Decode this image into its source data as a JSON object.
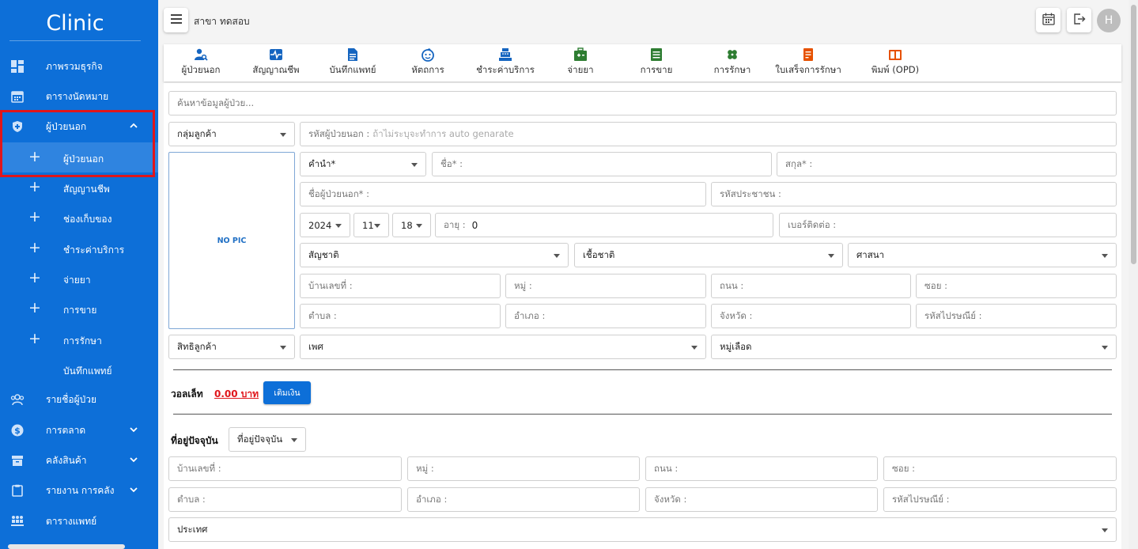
{
  "sidebar": {
    "brand": "Clinic",
    "items": [
      {
        "label": "ภาพรวมธุรกิจ",
        "icon": "dashboard-icon"
      },
      {
        "label": "ตารางนัดหมาย",
        "icon": "calendar-icon"
      },
      {
        "label": "ผู้ป่วยนอก",
        "icon": "shield-icon",
        "expanded": true
      },
      {
        "label": "รายชื่อผู้ป่วย",
        "icon": "users-icon"
      },
      {
        "label": "การตลาด",
        "icon": "dollar-icon"
      },
      {
        "label": "คลังสินค้า",
        "icon": "archive-icon"
      },
      {
        "label": "รายงาน การคลัง",
        "icon": "clipboard-icon"
      },
      {
        "label": "ตารางแพทย์",
        "icon": "doctors-icon"
      }
    ],
    "subitems": [
      {
        "label": "ผู้ป่วยนอก",
        "plus": true,
        "active": true
      },
      {
        "label": "สัญญานชีพ",
        "plus": true
      },
      {
        "label": "ช่องเก็บของ",
        "plus": true
      },
      {
        "label": "ชำระค่าบริการ",
        "plus": true
      },
      {
        "label": "จ่ายยา",
        "plus": true
      },
      {
        "label": "การขาย",
        "plus": true
      },
      {
        "label": "การรักษา",
        "plus": true
      },
      {
        "label": "บันทึกแพทย์",
        "plus": false
      }
    ]
  },
  "topbar": {
    "branch": "สาขา ทดสอบ",
    "avatar_letter": "H"
  },
  "tabs": [
    {
      "label": "ผู้ป่วยนอก",
      "icon": "patient-search-icon",
      "color": "#1565c0"
    },
    {
      "label": "สัญญาณชีพ",
      "icon": "vital-signs-icon",
      "color": "#1565c0"
    },
    {
      "label": "บันทึกแพทย์",
      "icon": "document-icon",
      "color": "#1565c0"
    },
    {
      "label": "หัตถการ",
      "icon": "baby-face-icon",
      "color": "#1565c0"
    },
    {
      "label": "ชำระค่าบริการ",
      "icon": "cash-register-icon",
      "color": "#1565c0"
    },
    {
      "label": "จ่ายยา",
      "icon": "medicine-kit-icon",
      "color": "#2e7d32"
    },
    {
      "label": "การขาย",
      "icon": "receipt-list-icon",
      "color": "#2e7d32"
    },
    {
      "label": "การรักษา",
      "icon": "bandage-icon",
      "color": "#2e7d32"
    },
    {
      "label": "ใบเสร็จการรักษา",
      "icon": "receipt-icon",
      "color": "#e65100"
    },
    {
      "label": "พิมพ์ (OPD)",
      "icon": "book-icon",
      "color": "#e65100"
    }
  ],
  "form": {
    "search_placeholder": "ค้นหาข้อมูลผู้ป่วย...",
    "customer_group": "กลุ่มลูกค้า",
    "patient_code_label": "รหัสผู้ป่วยนอก :",
    "patient_code_placeholder": "ถ้าไม่ระบุจะทำการ auto genarate",
    "no_pic": "NO PIC",
    "prefix": "คำนำ*",
    "first_name": "ชื่อ* :",
    "last_name": "สกุล* :",
    "outpatient_name": "ชื่อผู้ป่วยนอก* :",
    "citizen_id": "รหัสประชาชน :",
    "year": "2024",
    "month": "11",
    "day": "18",
    "age_label": "อายุ :",
    "age_value": "0",
    "phone": "เบอร์ติดต่อ :",
    "nationality": "สัญชาติ",
    "race": "เชื้อชาติ",
    "religion": "ศาสนา",
    "house_no": "บ้านเลขที่ :",
    "moo": "หมู่ :",
    "road": "ถนน :",
    "soi": "ซอย :",
    "subdistrict": "ตำบล :",
    "district": "อำเภอ :",
    "province": "จังหวัด :",
    "postcode": "รหัสไปรษณีย์ :",
    "customer_right": "สิทธิลูกค้า",
    "gender": "เพศ",
    "blood_group": "หมู่เลือด",
    "wallet_label": "วอลเล็ท",
    "wallet_amount": "0.00 บาท",
    "topup_label": "เติมเงิน",
    "current_address_label": "ที่อยู่ปัจจุบัน",
    "current_address_select": "ที่อยู่ปัจจุบัน",
    "country": "ประเทศ"
  }
}
